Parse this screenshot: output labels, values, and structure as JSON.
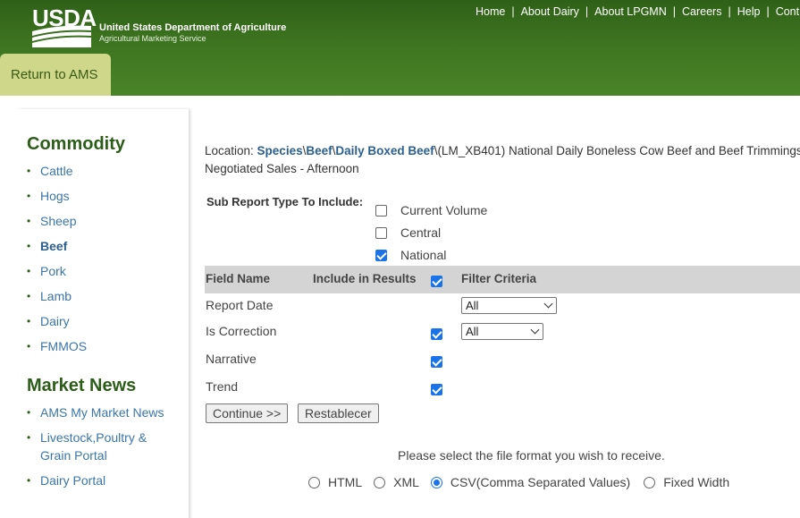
{
  "header": {
    "logo_text": "USDA",
    "agency_title": "United States Department of Agriculture",
    "agency_sub": "Agricultural Marketing Service",
    "nav": [
      "Home",
      "About Dairy",
      "About LPGMN",
      "Careers",
      "Help",
      "Cont"
    ],
    "return_tab": "Return to AMS",
    "colors": {
      "header_green": "#3d7420",
      "tab_bg": "#cfd88a"
    }
  },
  "sidebar": {
    "commodity_heading": "Commodity",
    "commodity_items": [
      {
        "label": "Cattle"
      },
      {
        "label": "Hogs"
      },
      {
        "label": "Sheep"
      },
      {
        "label": "Beef",
        "active": true
      },
      {
        "label": "Pork"
      },
      {
        "label": "Lamb"
      },
      {
        "label": "Dairy"
      },
      {
        "label": "FMMOS"
      }
    ],
    "market_news_heading": "Market News",
    "market_news_items": [
      {
        "label": "AMS My Market News"
      },
      {
        "label": "Livestock,Poultry &"
      },
      {
        "label": "Grain Portal"
      },
      {
        "label": "Dairy Portal"
      }
    ]
  },
  "location": {
    "prefix": "Location: ",
    "crumbs": [
      "Species",
      "Beef",
      "Daily Boxed Beef"
    ],
    "separator": "\\",
    "rest": "\\(LM_XB401) National Daily Boneless Cow Beef and Beef Trimmings",
    "line2": "Negotiated Sales - Afternoon"
  },
  "subreport": {
    "label": "Sub Report Type To Include:",
    "options": [
      {
        "label": "Current Volume",
        "checked": false
      },
      {
        "label": "Central",
        "checked": false
      },
      {
        "label": "National",
        "checked": true
      }
    ]
  },
  "table": {
    "col_field": "Field Name",
    "col_include": "Include in Results",
    "col_filter": "Filter Criteria",
    "include_all_checked": true,
    "rows": [
      {
        "field": "Report Date",
        "include": null,
        "filter": "All"
      },
      {
        "field": "Is Correction",
        "include": true,
        "filter": "All"
      },
      {
        "field": "Narrative",
        "include": true,
        "filter": null
      },
      {
        "field": "Trend",
        "include": true,
        "filter": null
      }
    ]
  },
  "buttons": {
    "continue": "Continue >>",
    "reset": "Restablecer"
  },
  "format": {
    "prompt": "Please select the file format you wish to receive.",
    "options": [
      {
        "label": "HTML",
        "checked": false
      },
      {
        "label": "XML",
        "checked": false
      },
      {
        "label": "CSV(Comma Separated Values)",
        "checked": true
      },
      {
        "label": "Fixed Width",
        "checked": false
      }
    ]
  }
}
